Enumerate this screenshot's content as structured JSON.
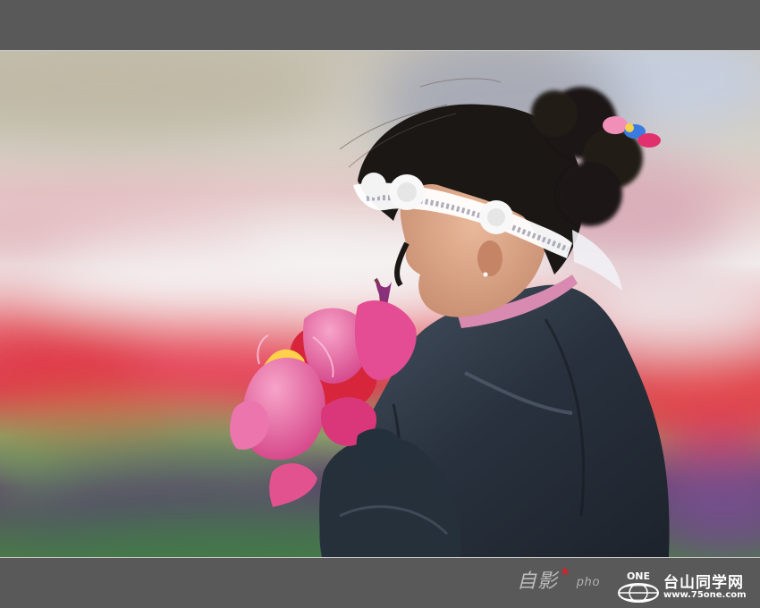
{
  "footer": {
    "signature": "自影",
    "photo_word": "pho",
    "logo_text": "ONE",
    "site_name": "台山同学网",
    "site_url": "www.75one.com"
  },
  "colors": {
    "frame": "#595959",
    "jacket": "#2a3340",
    "tulip_pink": "#e8579a",
    "tulip_red": "#d92a3a",
    "headband": "#ffffff",
    "hair": "#1a1614"
  },
  "scene": {
    "subject": "girl-with-headband",
    "icons": [
      "flower-bouquet-icon",
      "headband-icon",
      "hair-bow-icon"
    ]
  }
}
